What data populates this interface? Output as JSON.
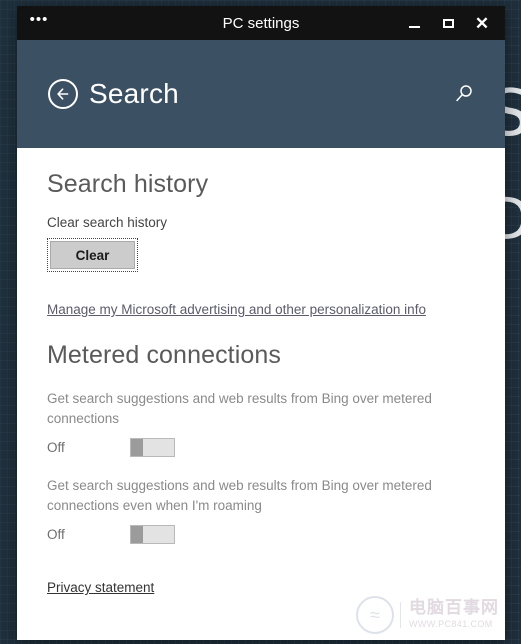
{
  "window": {
    "title": "PC settings",
    "menu_glyph": "•••",
    "buttons": {
      "menu_label": "...",
      "minimize_label": "Minimize",
      "maximize_label": "Maximize",
      "close_label": "Close"
    }
  },
  "header": {
    "title": "Search",
    "back_icon": "back-arrow-icon",
    "search_icon": "search-icon",
    "background_color": "#3c5064"
  },
  "sections": {
    "search_history": {
      "heading": "Search history",
      "clear_label": "Clear search history",
      "clear_button": "Clear",
      "manage_link": "Manage my Microsoft advertising and other personalization info"
    },
    "metered": {
      "heading": "Metered connections",
      "settings": [
        {
          "description": "Get search suggestions and web results from Bing over metered connections",
          "state": "Off"
        },
        {
          "description": "Get search suggestions and web results from Bing over metered connections even when I'm roaming",
          "state": "Off"
        }
      ]
    },
    "privacy_link": "Privacy statement"
  },
  "watermark": {
    "cn_text": "电脑百事网",
    "url_text": "WWW.PC841.COM"
  },
  "desktop": {
    "glyph_right": "S",
    "glyph_right2": "D"
  }
}
